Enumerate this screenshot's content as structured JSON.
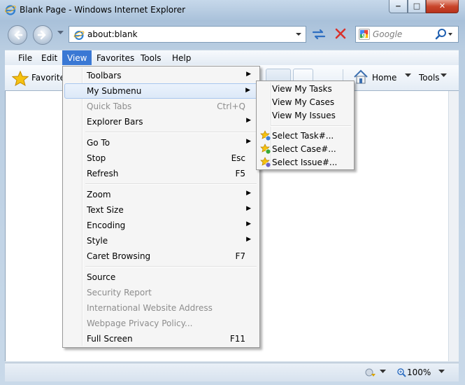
{
  "window": {
    "title": "Blank Page - Windows Internet Explorer",
    "caption_buttons": {
      "minimize": "‒",
      "maximize": "□",
      "close": "✕"
    }
  },
  "nav": {
    "address": "about:blank",
    "search_placeholder": "Google"
  },
  "menubar": {
    "items": [
      {
        "label": "File",
        "active": false
      },
      {
        "label": "Edit",
        "active": false
      },
      {
        "label": "View",
        "active": true
      },
      {
        "label": "Favorites",
        "active": false
      },
      {
        "label": "Tools",
        "active": false
      },
      {
        "label": "Help",
        "active": false
      }
    ]
  },
  "command_bar": {
    "favorites_label": "Favorites",
    "home_label": "Home",
    "tools_label": "Tools"
  },
  "view_menu": {
    "items": [
      {
        "label": "Toolbars",
        "shortcut": "",
        "submenu": true,
        "disabled": false
      },
      {
        "label": "My Submenu",
        "shortcut": "",
        "submenu": true,
        "disabled": false,
        "highlighted": true
      },
      {
        "label": "Quick Tabs",
        "shortcut": "Ctrl+Q",
        "submenu": false,
        "disabled": true
      },
      {
        "label": "Explorer Bars",
        "shortcut": "",
        "submenu": true,
        "disabled": false
      },
      {
        "label": "Go To",
        "shortcut": "",
        "submenu": true,
        "disabled": false
      },
      {
        "label": "Stop",
        "shortcut": "Esc",
        "submenu": false,
        "disabled": false
      },
      {
        "label": "Refresh",
        "shortcut": "F5",
        "submenu": false,
        "disabled": false
      },
      {
        "label": "Zoom",
        "shortcut": "",
        "submenu": true,
        "disabled": false
      },
      {
        "label": "Text Size",
        "shortcut": "",
        "submenu": true,
        "disabled": false
      },
      {
        "label": "Encoding",
        "shortcut": "",
        "submenu": true,
        "disabled": false
      },
      {
        "label": "Style",
        "shortcut": "",
        "submenu": true,
        "disabled": false
      },
      {
        "label": "Caret Browsing",
        "shortcut": "F7",
        "submenu": false,
        "disabled": false
      },
      {
        "label": "Source",
        "shortcut": "",
        "submenu": false,
        "disabled": false
      },
      {
        "label": "Security Report",
        "shortcut": "",
        "submenu": false,
        "disabled": true
      },
      {
        "label": "International Website Address",
        "shortcut": "",
        "submenu": false,
        "disabled": true
      },
      {
        "label": "Webpage Privacy Policy...",
        "shortcut": "",
        "submenu": false,
        "disabled": true
      },
      {
        "label": "Full Screen",
        "shortcut": "F11",
        "submenu": false,
        "disabled": false
      }
    ]
  },
  "submenu": {
    "items": [
      {
        "label": "View My Tasks",
        "icon": ""
      },
      {
        "label": "View My Cases",
        "icon": ""
      },
      {
        "label": "View My Issues",
        "icon": ""
      },
      {
        "label": "Select Task#...",
        "icon": "task-icon"
      },
      {
        "label": "Select Case#...",
        "icon": "case-icon"
      },
      {
        "label": "Select Issue#...",
        "icon": "issue-icon"
      }
    ]
  },
  "status_bar": {
    "zoom": "100%"
  },
  "colors": {
    "menu_highlight": "#3a78d4",
    "disabled_text": "#8d8d8d",
    "close_button": "#c9462c"
  }
}
